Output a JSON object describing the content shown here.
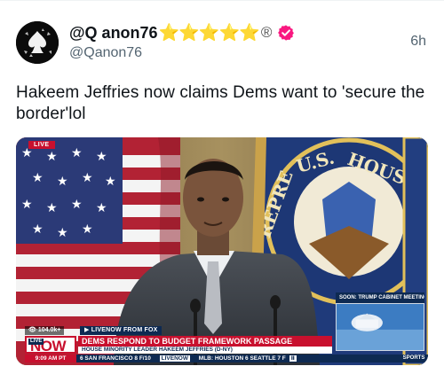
{
  "tweet": {
    "display_name": "@Q anon76",
    "stars": "⭐⭐⭐⭐⭐",
    "registered_mark": "®",
    "handle": "@Qanon76",
    "time": "6h",
    "text": "Hakeem Jeffries now claims Dems want to 'secure the border'lol"
  },
  "video": {
    "live_tag": "LIVE",
    "seal_text": "U.S. HOUSE OF REPRESENTATIVES",
    "pip_label": "SOON: TRUMP CABINET MEETING",
    "viewer_count": "👁 104.0k+",
    "source_tag": "▶ LIVENOW FROM FOX",
    "live_small": "LIVE",
    "now_label": "NOW",
    "headline": "DEMS RESPOND TO BUDGET FRAMEWORK PASSAGE",
    "subheadline": "HOUSE MINORITY LEADER HAKEEM JEFFRIES (D-NY)",
    "time_label": "9:09 AM PT",
    "ticker": {
      "item1": "6  SAN FRANCISCO  8  F/10",
      "logo": "LIVENOW",
      "item2": "MLB:  HOUSTON  6  SEATTLE  7  F",
      "logo2": "Ⅱ"
    },
    "sports_label": "SPORTS"
  },
  "colors": {
    "verified_badge": "#f91880",
    "fox_red": "#c8102e",
    "fox_navy": "#0e2a52",
    "star_gold": "#f2c21a"
  }
}
